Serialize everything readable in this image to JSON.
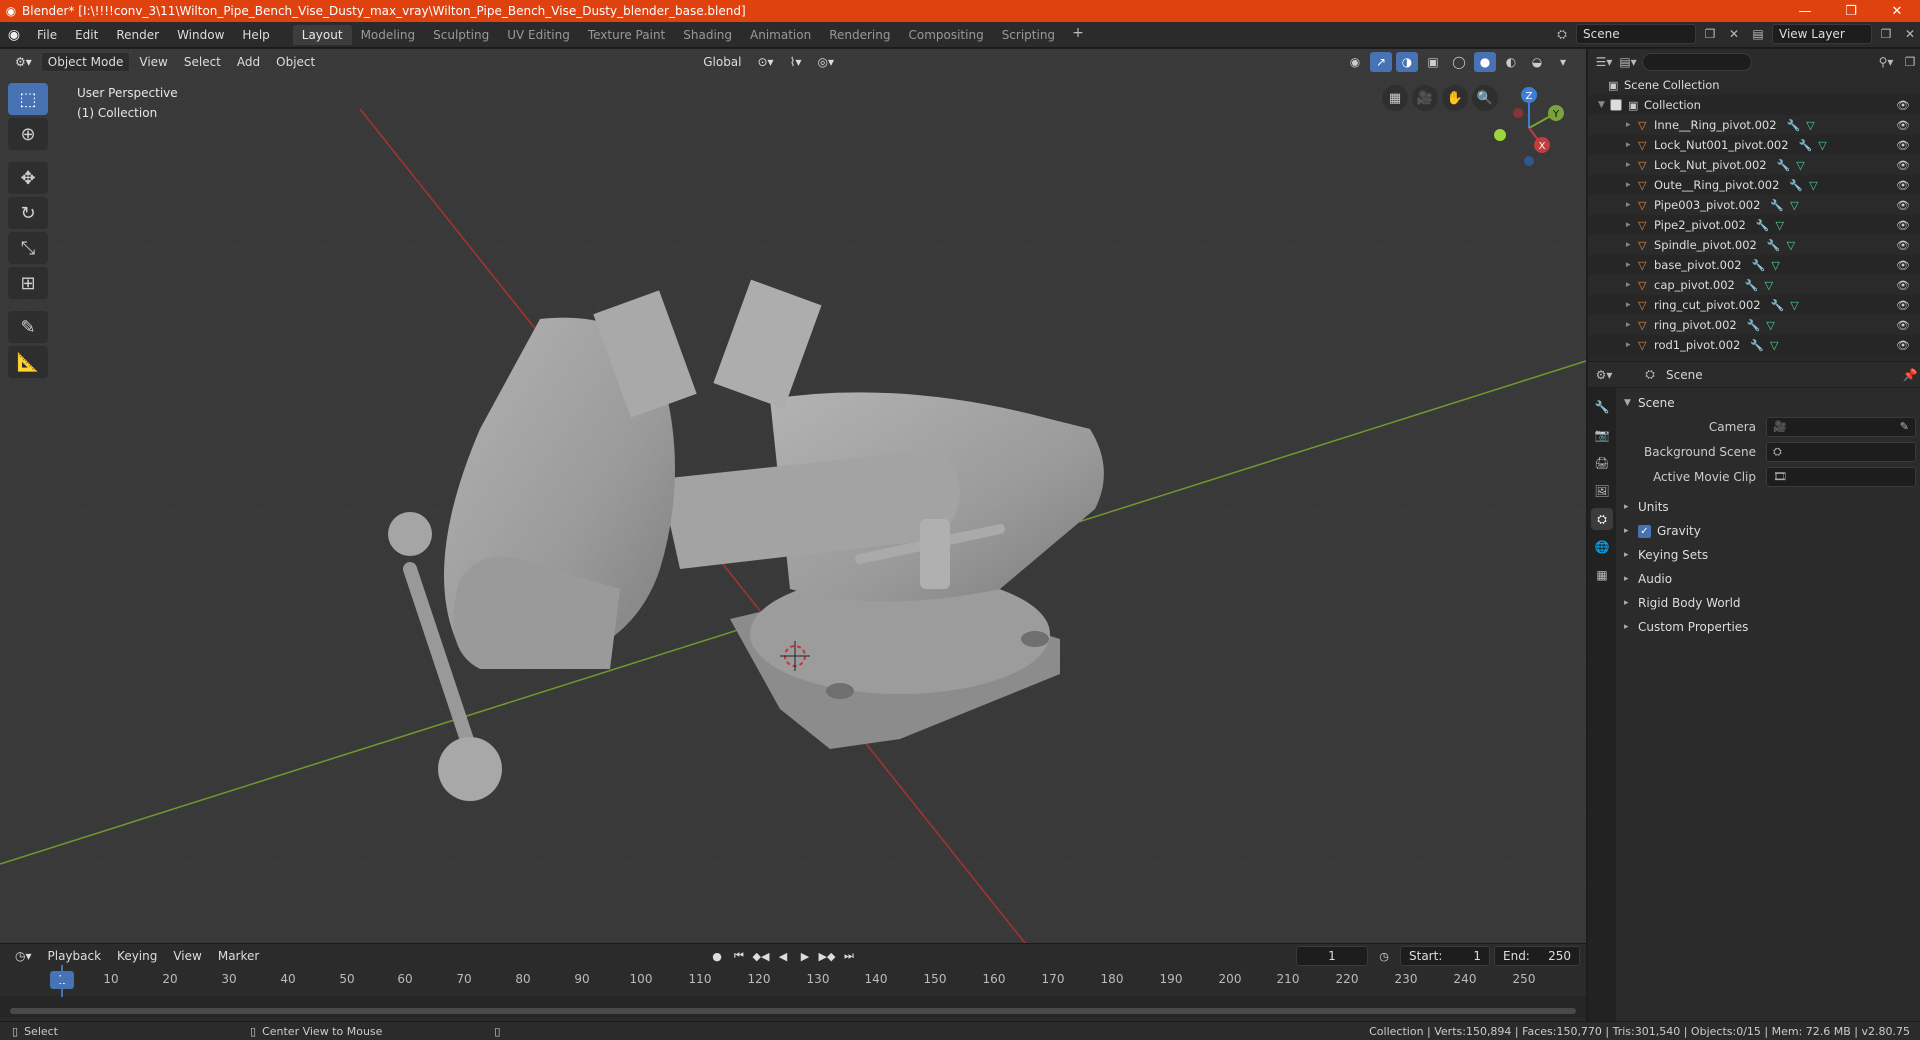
{
  "window": {
    "title": "Blender* [I:\\!!!!conv_3\\11\\Wilton_Pipe_Bench_Vise_Dusty_max_vray\\Wilton_Pipe_Bench_Vise_Dusty_blender_base.blend]",
    "minimize": "—",
    "restore": "❐",
    "close": "✕"
  },
  "menu": [
    "File",
    "Edit",
    "Render",
    "Window",
    "Help"
  ],
  "workspaces": [
    "Layout",
    "Modeling",
    "Sculpting",
    "UV Editing",
    "Texture Paint",
    "Shading",
    "Animation",
    "Rendering",
    "Compositing",
    "Scripting"
  ],
  "workspace_add": "+",
  "scene_field": "Scene",
  "view_layer_field": "View Layer",
  "viewport": {
    "mode": "Object Mode",
    "menus": [
      "View",
      "Select",
      "Add",
      "Object"
    ],
    "orientation": "Global",
    "info_line1": "User Perspective",
    "info_line2": "(1) Collection",
    "gizmo": {
      "x": "X",
      "y": "Y",
      "z": "Z"
    }
  },
  "timeline": {
    "menus": [
      "Playback",
      "Keying",
      "View",
      "Marker"
    ],
    "current_frame": "1",
    "start_label": "Start:",
    "start": "1",
    "end_label": "End:",
    "end": "250",
    "ticks": [
      "10",
      "20",
      "30",
      "40",
      "50",
      "60",
      "70",
      "80",
      "90",
      "100",
      "110",
      "120",
      "130",
      "140",
      "150",
      "160",
      "170",
      "180",
      "190",
      "200",
      "210",
      "220",
      "230",
      "240",
      "250"
    ],
    "marker": "1"
  },
  "statusbar": {
    "select": "Select",
    "center_view": "Center View to Mouse",
    "stats": "Collection | Verts:150,894 | Faces:150,770 | Tris:301,540 | Objects:0/15 | Mem: 72.6 MB | v2.80.75"
  },
  "outliner": {
    "search_placeholder": "",
    "scene_collection": "Scene Collection",
    "collection": "Collection",
    "items": [
      "Inne__Ring_pivot.002",
      "Lock_Nut001_pivot.002",
      "Lock_Nut_pivot.002",
      "Oute__Ring_pivot.002",
      "Pipe003_pivot.002",
      "Pipe2_pivot.002",
      "Spindle_pivot.002",
      "base_pivot.002",
      "cap_pivot.002",
      "ring_cut_pivot.002",
      "ring_pivot.002",
      "rod1_pivot.002"
    ]
  },
  "properties": {
    "header": "Scene",
    "panel": "Scene",
    "camera_label": "Camera",
    "background_scene_label": "Background Scene",
    "active_movie_clip_label": "Active Movie Clip",
    "subpanels": [
      "Units",
      "Gravity",
      "Keying Sets",
      "Audio",
      "Rigid Body World",
      "Custom Properties"
    ]
  },
  "colors": {
    "accent": "#4772b3",
    "titlebar": "#e0420f",
    "viewport_bg": "#393939",
    "x_axis": "#c23c3c",
    "y_axis": "#7aa33a"
  }
}
